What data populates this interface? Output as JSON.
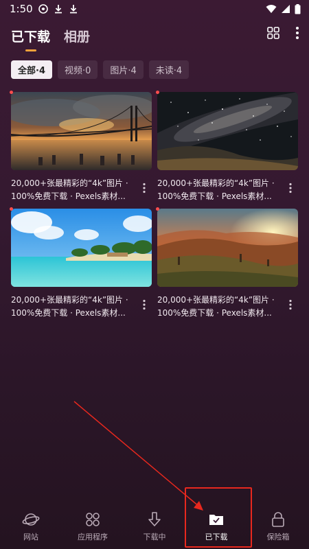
{
  "status": {
    "time": "1:50"
  },
  "header": {
    "tabs": [
      {
        "label": "已下载"
      },
      {
        "label": "相册"
      }
    ]
  },
  "filters": [
    {
      "label": "全部·4"
    },
    {
      "label": "视频·0"
    },
    {
      "label": "图片·4"
    },
    {
      "label": "未读·4"
    }
  ],
  "items": [
    {
      "line1": "20,000+张最精彩的“4k”图片 ·",
      "line2": "100%免费下载 · Pexels素材..."
    },
    {
      "line1": "20,000+张最精彩的“4k”图片 ·",
      "line2": "100%免费下载 · Pexels素材..."
    },
    {
      "line1": "20,000+张最精彩的“4k”图片 ·",
      "line2": "100%免费下载 · Pexels素材..."
    },
    {
      "line1": "20,000+张最精彩的“4k”图片 ·",
      "line2": "100%免费下载 · Pexels素材..."
    }
  ],
  "bottom_nav": [
    {
      "label": "网站"
    },
    {
      "label": "应用程序"
    },
    {
      "label": "下载中"
    },
    {
      "label": "已下载"
    },
    {
      "label": "保险箱"
    }
  ],
  "colors": {
    "accent": "#f2a23a",
    "unread_dot": "#ff4d4d",
    "annotation": "#e8281e"
  }
}
